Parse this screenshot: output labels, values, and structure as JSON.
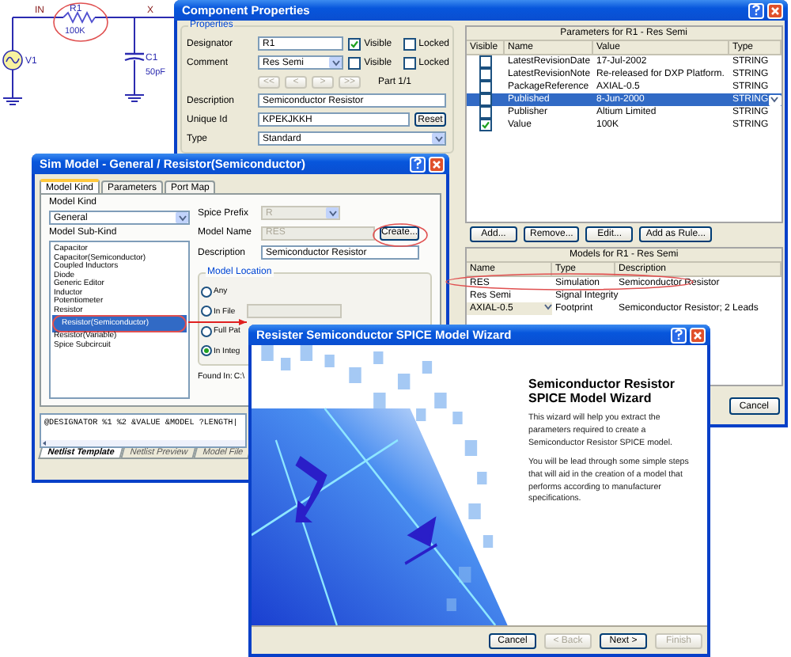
{
  "schematic": {
    "nets": [
      "IN",
      "X"
    ],
    "parts": [
      {
        "designator": "R1",
        "value": "100K"
      },
      {
        "designator": "V1"
      },
      {
        "designator": "C1",
        "value": "50pF"
      }
    ]
  },
  "component_properties": {
    "title": "Component Properties",
    "group": "Properties",
    "fields": [
      {
        "kind": "text",
        "label": "Designator",
        "value": "R1",
        "checks": [
          {
            "label": "Visible",
            "checked": true
          },
          {
            "label": "Locked",
            "checked": false
          }
        ]
      },
      {
        "kind": "dropdown",
        "label": "Comment",
        "value": "Res Semi",
        "checks": [
          {
            "label": "Visible",
            "checked": false
          },
          {
            "label": "Locked",
            "checked": false
          }
        ]
      },
      {
        "kind": "nav",
        "buttons": [
          "<<",
          "<",
          ">",
          ">>"
        ],
        "part": "Part 1/1"
      },
      {
        "kind": "text",
        "label": "Description",
        "value": "Semiconductor Resistor"
      },
      {
        "kind": "button",
        "label": "Unique Id",
        "value": "KPEKJKKH",
        "button": "Reset"
      },
      {
        "kind": "dropdown",
        "label": "Type",
        "value": "Standard"
      }
    ],
    "parameters": {
      "title": "Parameters for R1 - Res Semi",
      "columns": [
        "Visible",
        "Name",
        "Value",
        "Type"
      ],
      "rows": [
        {
          "visible": false,
          "name": "LatestRevisionDate",
          "value": "17-Jul-2002",
          "type": "STRING",
          "selected": false
        },
        {
          "visible": false,
          "name": "LatestRevisionNote",
          "value": "Re-released for DXP Platform.",
          "type": "STRING",
          "selected": false
        },
        {
          "visible": false,
          "name": "PackageReference",
          "value": "AXIAL-0.5",
          "type": "STRING",
          "selected": false
        },
        {
          "visible": false,
          "name": "Published",
          "value": "8-Jun-2000",
          "type": "STRING",
          "selected": true
        },
        {
          "visible": false,
          "name": "Publisher",
          "value": "Altium Limited",
          "type": "STRING",
          "selected": false
        },
        {
          "visible": true,
          "name": "Value",
          "value": "100K",
          "type": "STRING",
          "selected": false
        }
      ]
    },
    "parameter_buttons": [
      "Add...",
      "Remove...",
      "Edit...",
      "Add as Rule..."
    ],
    "models": {
      "title": "Models for R1 - Res Semi",
      "columns": [
        "Name",
        "Type",
        "Description"
      ],
      "rows": [
        {
          "name": "RES",
          "type": "Simulation",
          "description": "Semiconductor Resistor",
          "dropdown": false
        },
        {
          "name": "Res Semi",
          "type": "Signal Integrity",
          "dropdown": false
        },
        {
          "name": "AXIAL-0.5",
          "type": "Footprint",
          "description": "Semiconductor Resistor; 2 Leads",
          "dropdown": true
        }
      ]
    },
    "dialog_buttons": [
      "Cancel"
    ]
  },
  "sim_model": {
    "title": "Sim Model - General / Resistor(Semiconductor)",
    "tabs": [
      {
        "label": "Model Kind",
        "selected": true
      },
      {
        "label": "Parameters",
        "selected": false
      },
      {
        "label": "Port Map",
        "selected": false
      }
    ],
    "model_kind": {
      "label": "Model Kind",
      "value": "General"
    },
    "sub_kind": {
      "label": "Model Sub-Kind",
      "items": [
        {
          "label": "Capacitor",
          "selected": false
        },
        {
          "label": "Capacitor(Semiconductor)",
          "selected": false
        },
        {
          "label": "Coupled Inductors",
          "selected": false
        },
        {
          "label": "Diode",
          "selected": false
        },
        {
          "label": "Generic Editor",
          "selected": false
        },
        {
          "label": "Inductor",
          "selected": false
        },
        {
          "label": "Potentiometer",
          "selected": false
        },
        {
          "label": "Resistor",
          "selected": false
        },
        {
          "label": "Resistor(Semiconductor)",
          "selected": true
        },
        {
          "label": "Resistor(Variable)",
          "selected": false
        },
        {
          "label": "Spice Subcircuit",
          "selected": false
        }
      ]
    },
    "spice_prefix": {
      "label": "Spice Prefix",
      "value": "R",
      "disabled": true
    },
    "model_name": {
      "label": "Model Name",
      "value": "RES",
      "disabled": true
    },
    "create_button": "Create...",
    "description": {
      "label": "Description",
      "value": "Semiconductor Resistor"
    },
    "location": {
      "label": "Model Location",
      "options": [
        {
          "label": "Any",
          "selected": false
        },
        {
          "label": "In File",
          "selected": false
        },
        {
          "label": "Full Pat",
          "selected": false
        },
        {
          "label": "In Integ",
          "selected": true
        }
      ]
    },
    "found_in": {
      "label": "Found In:",
      "value": "C:\\"
    },
    "netlist_template": "@DESIGNATOR %1 %2 &VALUE &MODEL ?LENGTH|",
    "bottom_tabs": [
      {
        "label": "Netlist Template",
        "selected": true
      },
      {
        "label": "Netlist Preview",
        "selected": false
      },
      {
        "label": "Model File",
        "selected": false
      }
    ]
  },
  "wizard": {
    "title": "Resister Semiconductor SPICE Model Wizard",
    "heading": "Semiconductor Resistor SPICE Model Wizard",
    "paragraphs": [
      "This wizard will help you extract the parameters required to create a Semiconductor Resistor SPICE model.",
      "You will be lead through some simple steps that will aid in the creation of a model that performs according to manufacturer specifications."
    ],
    "buttons": [
      {
        "label": "Cancel",
        "disabled": false
      },
      {
        "label": "< Back",
        "disabled": true
      },
      {
        "label": "Next >",
        "disabled": false
      },
      {
        "label": "Finish",
        "disabled": true
      }
    ]
  }
}
